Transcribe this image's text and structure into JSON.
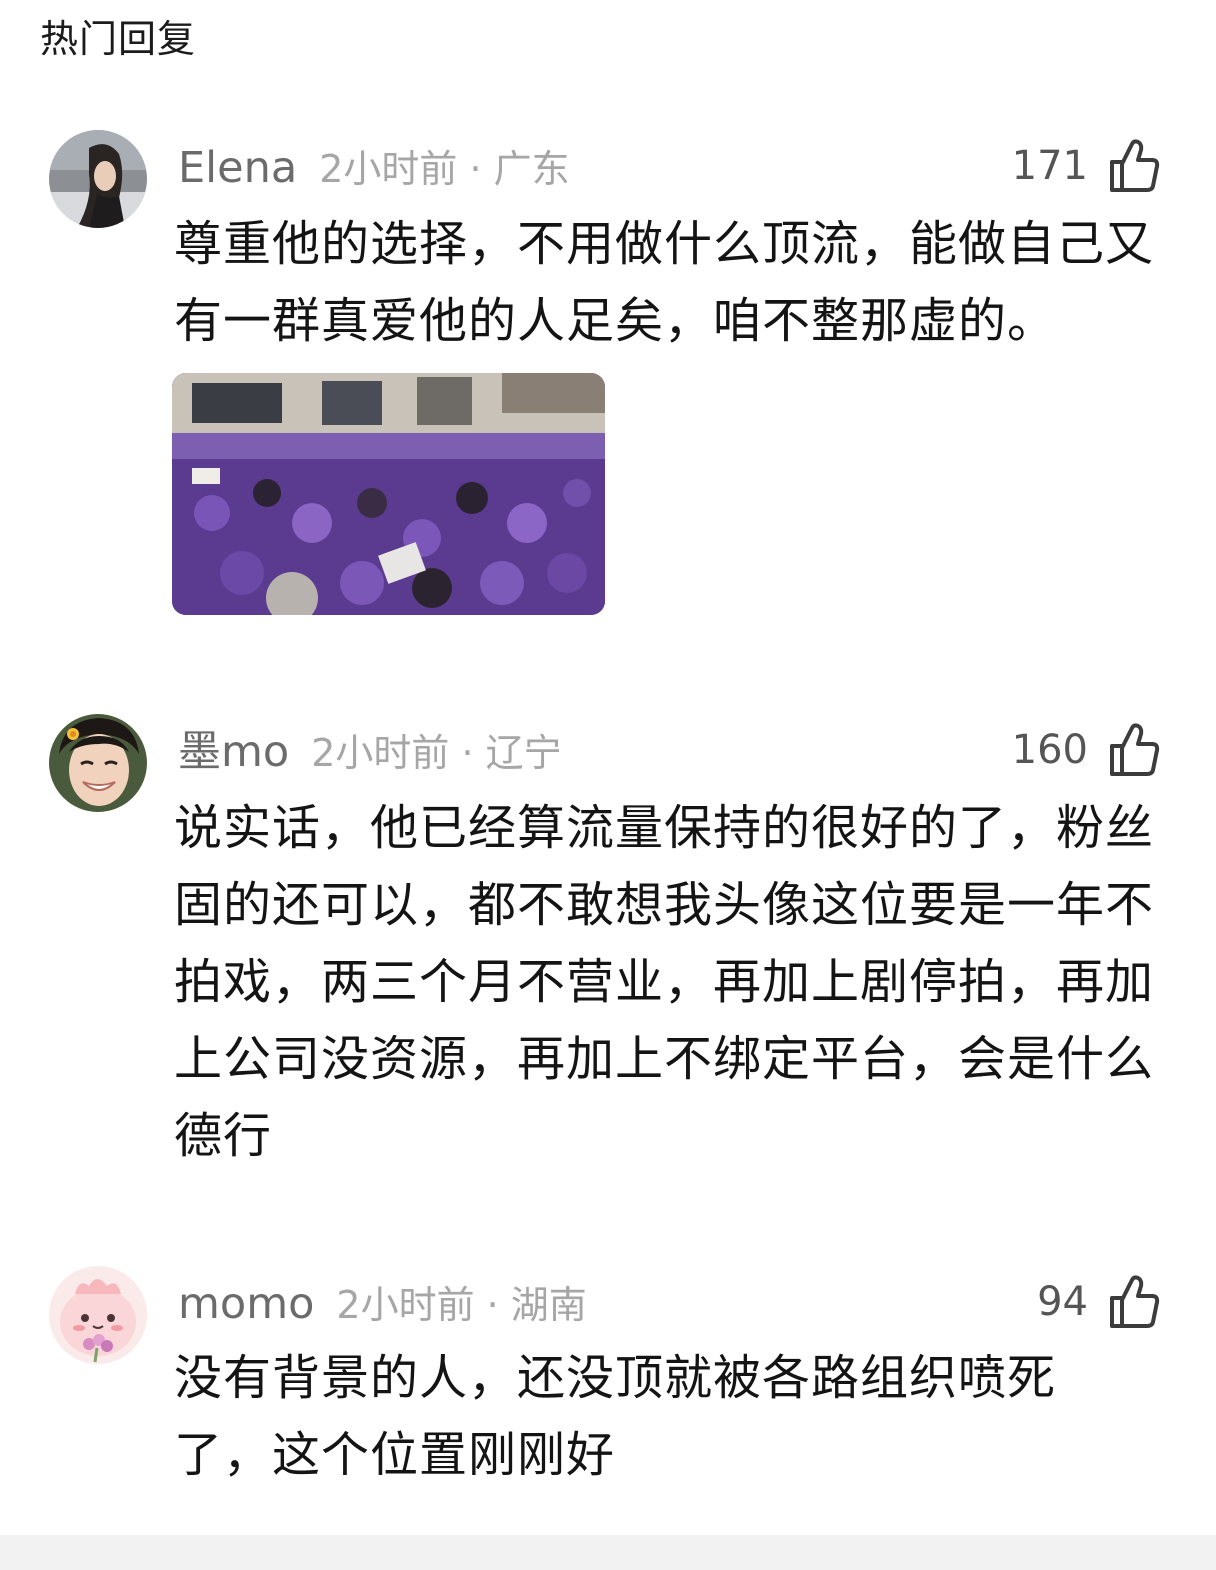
{
  "section": {
    "title": "热门回复"
  },
  "comments": [
    {
      "username": "Elena",
      "time_location": "2小时前 · 广东",
      "likes": "171",
      "text": "尊重他的选择，不用做什么顶流，能做自己又有一群真爱他的人足矣，咱不整那虚的。",
      "avatar_icon": "woman-portrait-avatar",
      "has_image": true,
      "image_icon": "crowd-in-purple-photo"
    },
    {
      "username": "墨mo",
      "time_location": "2小时前 · 辽宁",
      "likes": "160",
      "text": "说实话，他已经算流量保持的很好的了，粉丝固的还可以，都不敢想我头像这位要是一年不拍戏，两三个月不营业，再加上剧停拍，再加上公司没资源，再加上不绑定平台，会是什么德行",
      "avatar_icon": "smiling-man-avatar"
    },
    {
      "username": "momo",
      "time_location": "2小时前 · 湖南",
      "likes": "94",
      "text": "没有背景的人，还没顶就被各路组织喷死了，这个位置刚刚好",
      "avatar_icon": "pink-cartoon-avatar"
    }
  ],
  "colors": {
    "username": "#6b6b6b",
    "meta": "#a6a6a6",
    "body": "#141414",
    "photo_purple": "#6a4aa0"
  }
}
